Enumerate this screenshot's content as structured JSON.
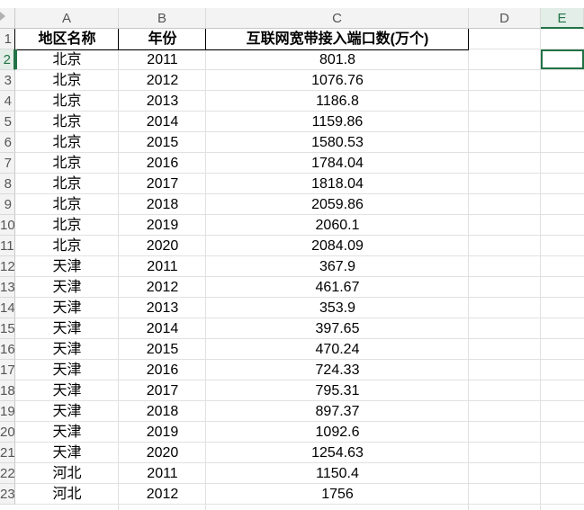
{
  "columns": [
    "A",
    "B",
    "C",
    "D",
    "E"
  ],
  "row_numbers": [
    "1",
    "2",
    "3",
    "4",
    "5",
    "6",
    "7",
    "8",
    "9",
    "10",
    "11",
    "12",
    "13",
    "14",
    "15",
    "16",
    "17",
    "18",
    "19",
    "20",
    "21",
    "22",
    "23"
  ],
  "header": {
    "region": "地区名称",
    "year": "年份",
    "value": "互联网宽带接入端口数(万个)"
  },
  "rows": [
    {
      "region": "北京",
      "year": "2011",
      "value": "801.8"
    },
    {
      "region": "北京",
      "year": "2012",
      "value": "1076.76"
    },
    {
      "region": "北京",
      "year": "2013",
      "value": "1186.8"
    },
    {
      "region": "北京",
      "year": "2014",
      "value": "1159.86"
    },
    {
      "region": "北京",
      "year": "2015",
      "value": "1580.53"
    },
    {
      "region": "北京",
      "year": "2016",
      "value": "1784.04"
    },
    {
      "region": "北京",
      "year": "2017",
      "value": "1818.04"
    },
    {
      "region": "北京",
      "year": "2018",
      "value": "2059.86"
    },
    {
      "region": "北京",
      "year": "2019",
      "value": "2060.1"
    },
    {
      "region": "北京",
      "year": "2020",
      "value": "2084.09"
    },
    {
      "region": "天津",
      "year": "2011",
      "value": "367.9"
    },
    {
      "region": "天津",
      "year": "2012",
      "value": "461.67"
    },
    {
      "region": "天津",
      "year": "2013",
      "value": "353.9"
    },
    {
      "region": "天津",
      "year": "2014",
      "value": "397.65"
    },
    {
      "region": "天津",
      "year": "2015",
      "value": "470.24"
    },
    {
      "region": "天津",
      "year": "2016",
      "value": "724.33"
    },
    {
      "region": "天津",
      "year": "2017",
      "value": "795.31"
    },
    {
      "region": "天津",
      "year": "2018",
      "value": "897.37"
    },
    {
      "region": "天津",
      "year": "2019",
      "value": "1092.6"
    },
    {
      "region": "天津",
      "year": "2020",
      "value": "1254.63"
    },
    {
      "region": "河北",
      "year": "2011",
      "value": "1150.4"
    },
    {
      "region": "河北",
      "year": "2012",
      "value": "1756"
    }
  ],
  "active_cell": "E2",
  "colors": {
    "selection": "#217346",
    "header_bg": "#f3f3f3",
    "grid": "#e1e1e1"
  }
}
